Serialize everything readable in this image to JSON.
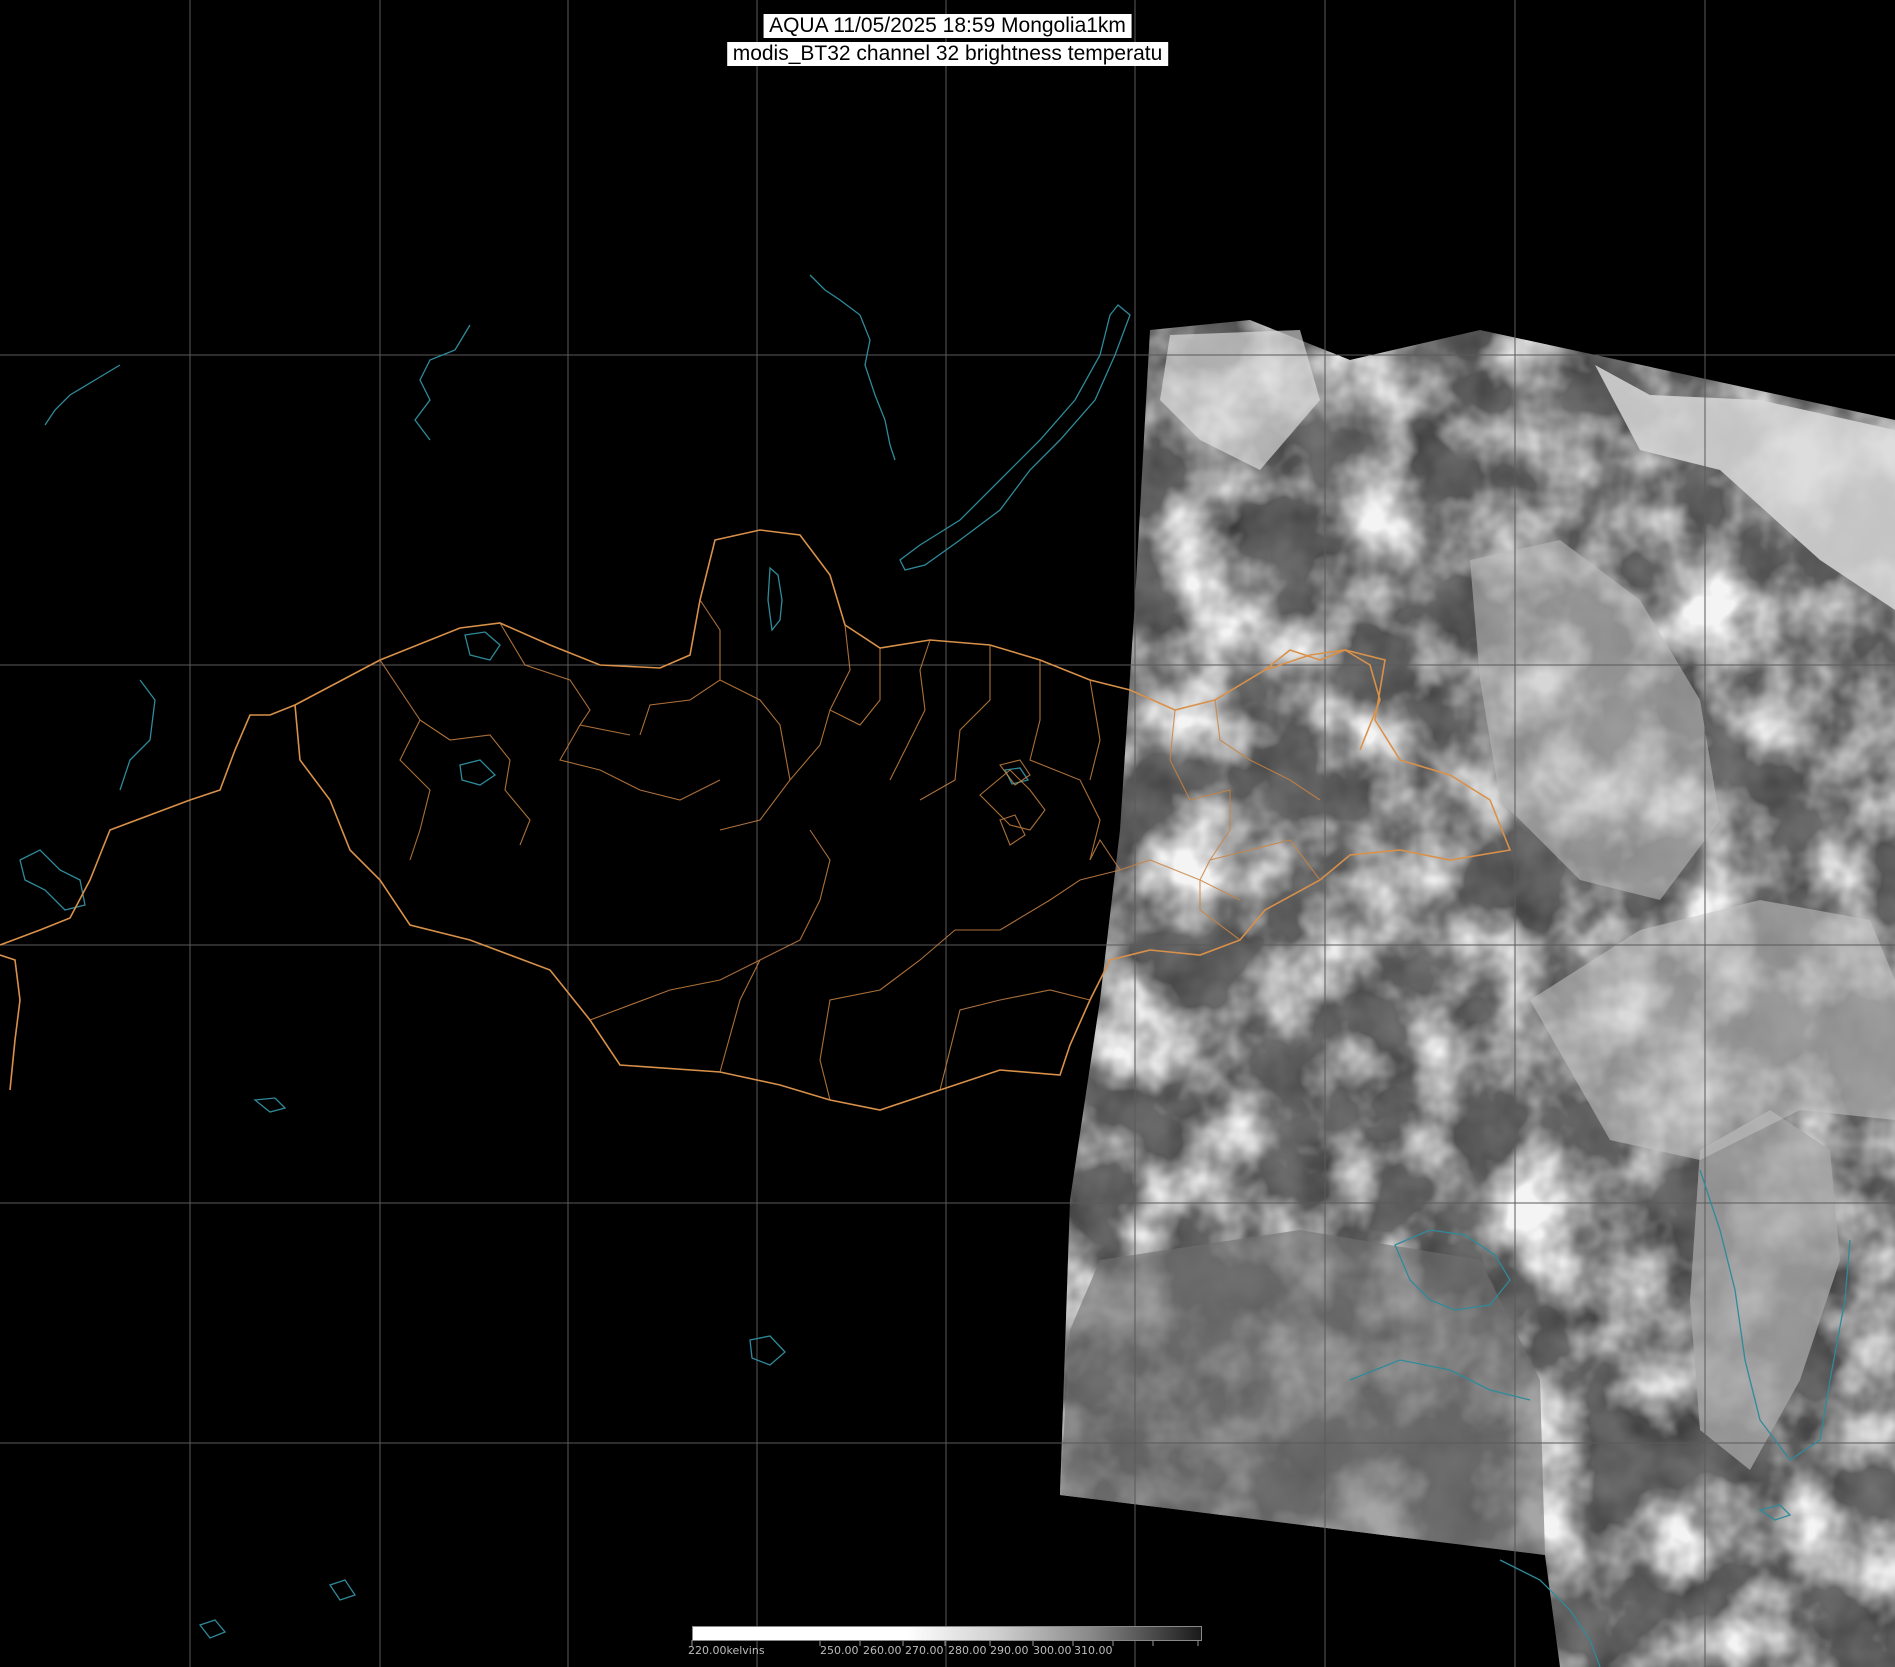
{
  "title": {
    "line1": "AQUA 11/05/2025 18:59 Mongolia1km",
    "line2": "modis_BT32 channel 32 brightness temperatu"
  },
  "colorbar": {
    "labels": [
      "220.00kelvins",
      "250.00",
      "260.00",
      "270.00",
      "280.00",
      "290.00",
      "300.00",
      "310.00"
    ],
    "gradient_start": "#ffffff",
    "gradient_end": "#000000"
  },
  "colors": {
    "background": "#000000",
    "grid": "#5a5a5a",
    "country_border": "#d9914a",
    "coastline_water": "#2f8a9a",
    "cloud_bright": "#e6e6e6",
    "cloud_dim": "#8a8a8a"
  },
  "map_layers": [
    "lat-lon-grid",
    "province-borders",
    "country-border",
    "lakes-and-rivers",
    "coastline",
    "satellite-swath"
  ]
}
